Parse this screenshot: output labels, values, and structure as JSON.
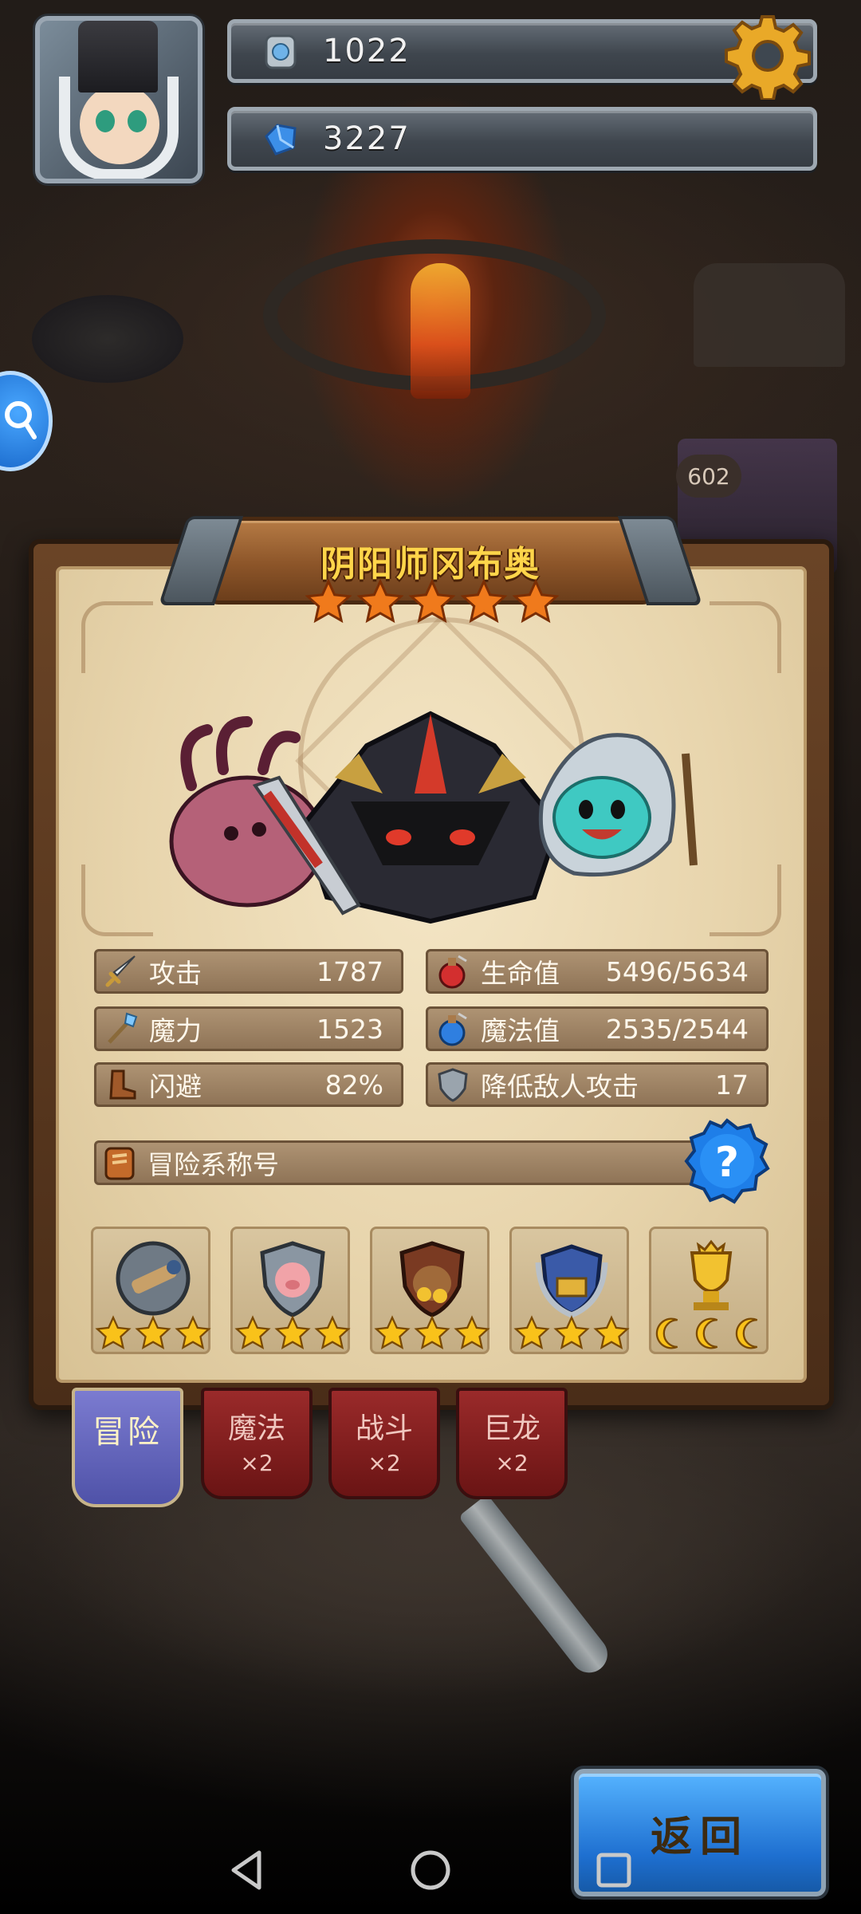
{
  "resources": {
    "stones": {
      "value": "1022",
      "icon": "silver-stone-icon"
    },
    "gems": {
      "value": "3227",
      "icon": "blue-gem-icon"
    }
  },
  "map_badge": "602",
  "hero": {
    "name": "阴阳师冈布奥",
    "stars": 5
  },
  "stats": {
    "attack": {
      "label": "攻击",
      "value": "1787",
      "icon": "sword-icon"
    },
    "hp": {
      "label": "生命值",
      "value": "5496/5634",
      "icon": "red-potion-icon"
    },
    "magic": {
      "label": "魔力",
      "value": "1523",
      "icon": "staff-icon"
    },
    "mp": {
      "label": "魔法值",
      "value": "2535/2544",
      "icon": "blue-potion-icon"
    },
    "dodge": {
      "label": "闪避",
      "value": "82%",
      "icon": "boot-icon"
    },
    "damage_reduction": {
      "label": "降低敌人攻击",
      "value": "17",
      "icon": "shield-icon"
    }
  },
  "title_section": {
    "label": "冒险系称号",
    "icon": "scroll-icon"
  },
  "achievements": [
    {
      "icon": "telescope-emblem-icon",
      "stars": 3
    },
    {
      "icon": "pig-shield-emblem-icon",
      "stars": 3
    },
    {
      "icon": "coin-bag-emblem-icon",
      "stars": 3
    },
    {
      "icon": "treasure-laurel-emblem-icon",
      "stars": 3
    },
    {
      "icon": "golden-trophy-emblem-icon",
      "stars": 3
    }
  ],
  "tabs": [
    {
      "label": "冒险",
      "sub": ""
    },
    {
      "label": "魔法",
      "sub": "×2"
    },
    {
      "label": "战斗",
      "sub": "×2"
    },
    {
      "label": "巨龙",
      "sub": "×2"
    }
  ],
  "back_button": "返回",
  "colors": {
    "gold_text": "#ffd54a",
    "panel_parchment": "#e8d5ad",
    "active_tab": "#4f52a8",
    "inactive_tab": "#9a2a2a",
    "back_button": "#1e6fd0"
  }
}
